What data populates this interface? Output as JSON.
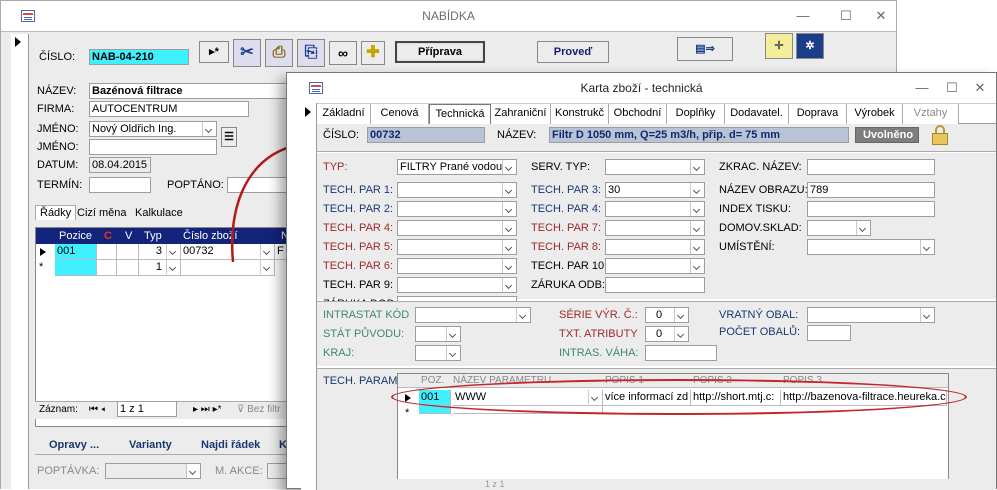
{
  "nabidka": {
    "title": "NABÍDKA",
    "win_controls": [
      "—",
      "☐",
      "✕"
    ],
    "cislo_label": "ČÍSLO:",
    "cislo_value": "NAB-04-210",
    "priprava_label": "Příprava",
    "provede_label": "Proveď",
    "nazev_label": "NÁZEV:",
    "nazev_value": "Bazénová filtrace",
    "firma_label": "FIRMA:",
    "firma_value": "AUTOCENTRUM",
    "jmeno_label": "JMÉNO:",
    "jmeno_value": "Nový Oldřich Ing.",
    "jmeno2_label": "JMÉNO:",
    "jmeno2_value": "",
    "datum_label": "DATUM:",
    "datum_value": "08.04.2015",
    "termin_label": "TERMÍN:",
    "poptano_label": "POPTÁNO:",
    "tabs": [
      "Řádky",
      "Cizí měna",
      "Kalkulace"
    ],
    "grid_headers": [
      "Pozice",
      "C",
      "V",
      "Typ",
      "Číslo zboží",
      "N"
    ],
    "grid_row": {
      "pozice": "001",
      "typ": "3",
      "cislo": "00732",
      "n": "F"
    },
    "grid_new": {
      "typ": "1"
    },
    "zaznam_label": "Záznam:",
    "zaznam_value": "1 z 1",
    "bez_filtru": "Bez filtr",
    "bottom_buttons": [
      "Opravy ...",
      "Varianty",
      "Najdi řádek",
      "K"
    ],
    "poptavka_label": "POPTÁVKA:",
    "makce_label": "M. AKCE:"
  },
  "karta": {
    "title": "Karta zboží - technická",
    "win_controls": [
      "—",
      "☐",
      "✕"
    ],
    "tabs": [
      "Základní",
      "Cenová",
      "Technická",
      "Zahraniční",
      "Konstrukč",
      "Obchodní",
      "Doplňky",
      "Dodavatel.",
      "Doprava",
      "Výrobek",
      "Vztahy"
    ],
    "cislo_label": "ČÍSLO:",
    "cislo_value": "00732",
    "nazev_label": "NÁZEV:",
    "nazev_value": "Filtr D 1050 mm, Q=25 m3/h, přip. d= 75 mm",
    "status": "Uvolněno",
    "typ_label": "TYP:",
    "typ_value": "FILTRY Prané vodou",
    "tech_labels_1": [
      "TECH. PAR 1:",
      "TECH. PAR 2:",
      "TECH. PAR 4:",
      "TECH. PAR 5:",
      "TECH. PAR 6:",
      "TECH. PAR 9:",
      "ZÁRUKA DOD:"
    ],
    "serv_typ_label": "SERV. TYP:",
    "tech_labels_2": [
      "TECH. PAR 3:",
      "TECH. PAR 4:",
      "TECH. PAR 7:",
      "TECH. PAR 8:",
      "TECH. PAR 10:",
      "ZÁRUKA ODB:"
    ],
    "tech_par3_value": "30",
    "zkrac_label": "ZKRAC. NÁZEV:",
    "nazev_obrazu_label": "NÁZEV OBRAZU:",
    "nazev_obrazu_value": "789",
    "index_tisku_label": "INDEX TISKU:",
    "domov_sklad_label": "DOMOV.SKLAD:",
    "umisteni_label": "UMÍSTĚNÍ:",
    "intrastat_label": "INTRASTAT KÓD",
    "stat_label": "STÁT PŮVODU:",
    "kraj_label": "KRAJ:",
    "serie_label": "SÉRIE VÝR. Č.:",
    "serie_value": "0",
    "txt_label": "TXT. ATRIBUTY",
    "txt_value": "0",
    "intras_vaha_label": "INTRAS. VÁHA:",
    "vratny_label": "VRATNÝ OBAL:",
    "pocet_label": "POČET OBALŮ:",
    "tech_param_label": "TECH. PARAM",
    "param_headers": [
      "POZ.",
      "NÁZEV PARAMETRU",
      "POPIS 1",
      "POPIS 2",
      "POPIS 3"
    ],
    "param_row": {
      "poz": "001",
      "nazev": "WWW",
      "popis1": "více informací zd",
      "popis2": "http://short.mtj.c:",
      "popis3": "http://bazenova-filtrace.heureka.cz"
    },
    "bottom_zaznam": "1 z 1"
  }
}
